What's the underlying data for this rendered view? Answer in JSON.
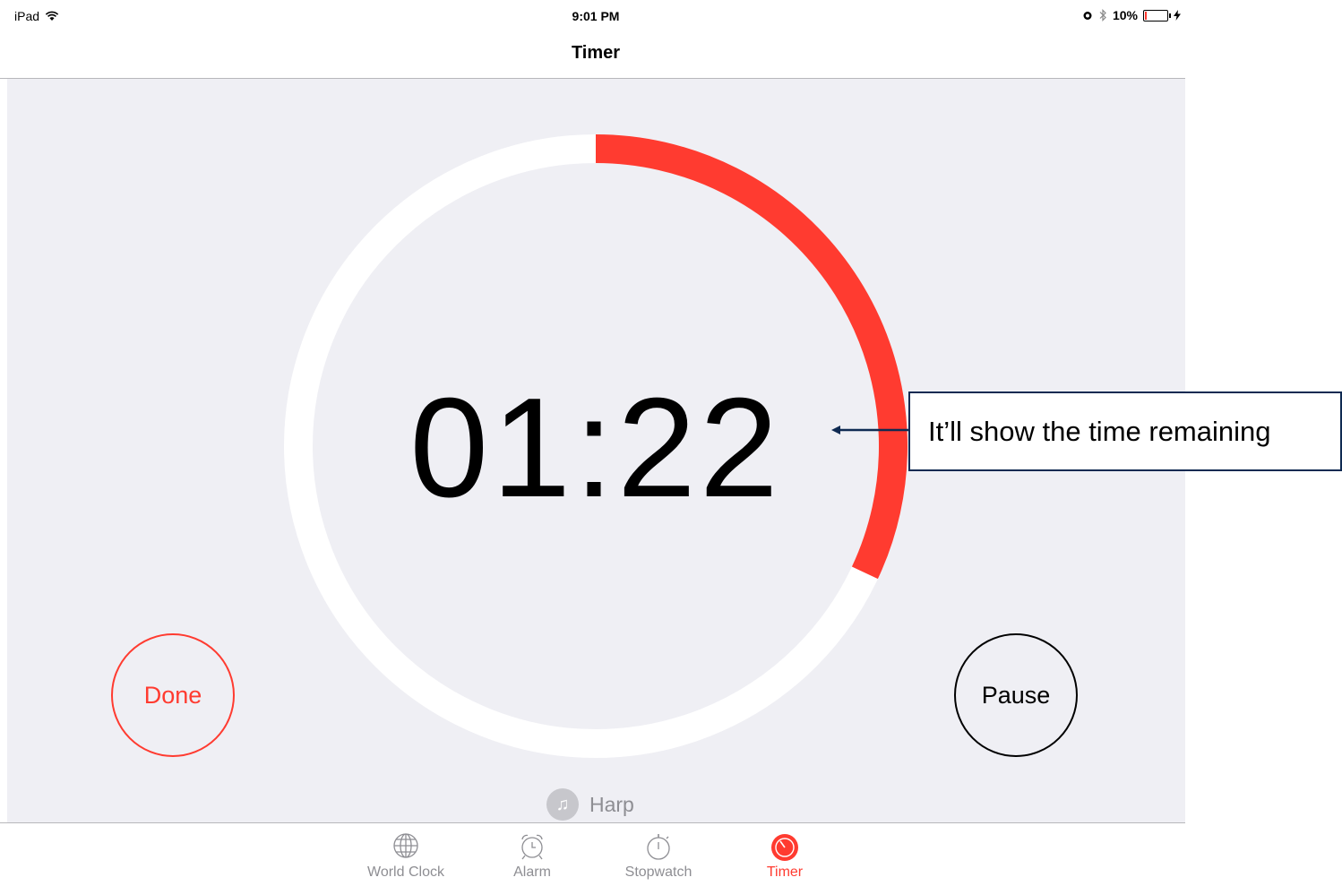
{
  "status_bar": {
    "device": "iPad",
    "time": "9:01 PM",
    "battery": "10%",
    "battery_level": 0.1
  },
  "nav": {
    "title": "Timer"
  },
  "timer": {
    "display": "01:22",
    "progress_remaining": 0.32,
    "accent_color": "#ff3b30"
  },
  "buttons": {
    "done": "Done",
    "pause": "Pause"
  },
  "sound": {
    "name": "Harp",
    "icon": "music-note-icon"
  },
  "tabs": [
    {
      "label": "World Clock",
      "icon": "globe-icon",
      "active": false
    },
    {
      "label": "Alarm",
      "icon": "alarm-clock-icon",
      "active": false
    },
    {
      "label": "Stopwatch",
      "icon": "stopwatch-icon",
      "active": false
    },
    {
      "label": "Timer",
      "icon": "timer-icon",
      "active": true
    }
  ],
  "annotation": {
    "text": "It’ll show the time remaining"
  }
}
